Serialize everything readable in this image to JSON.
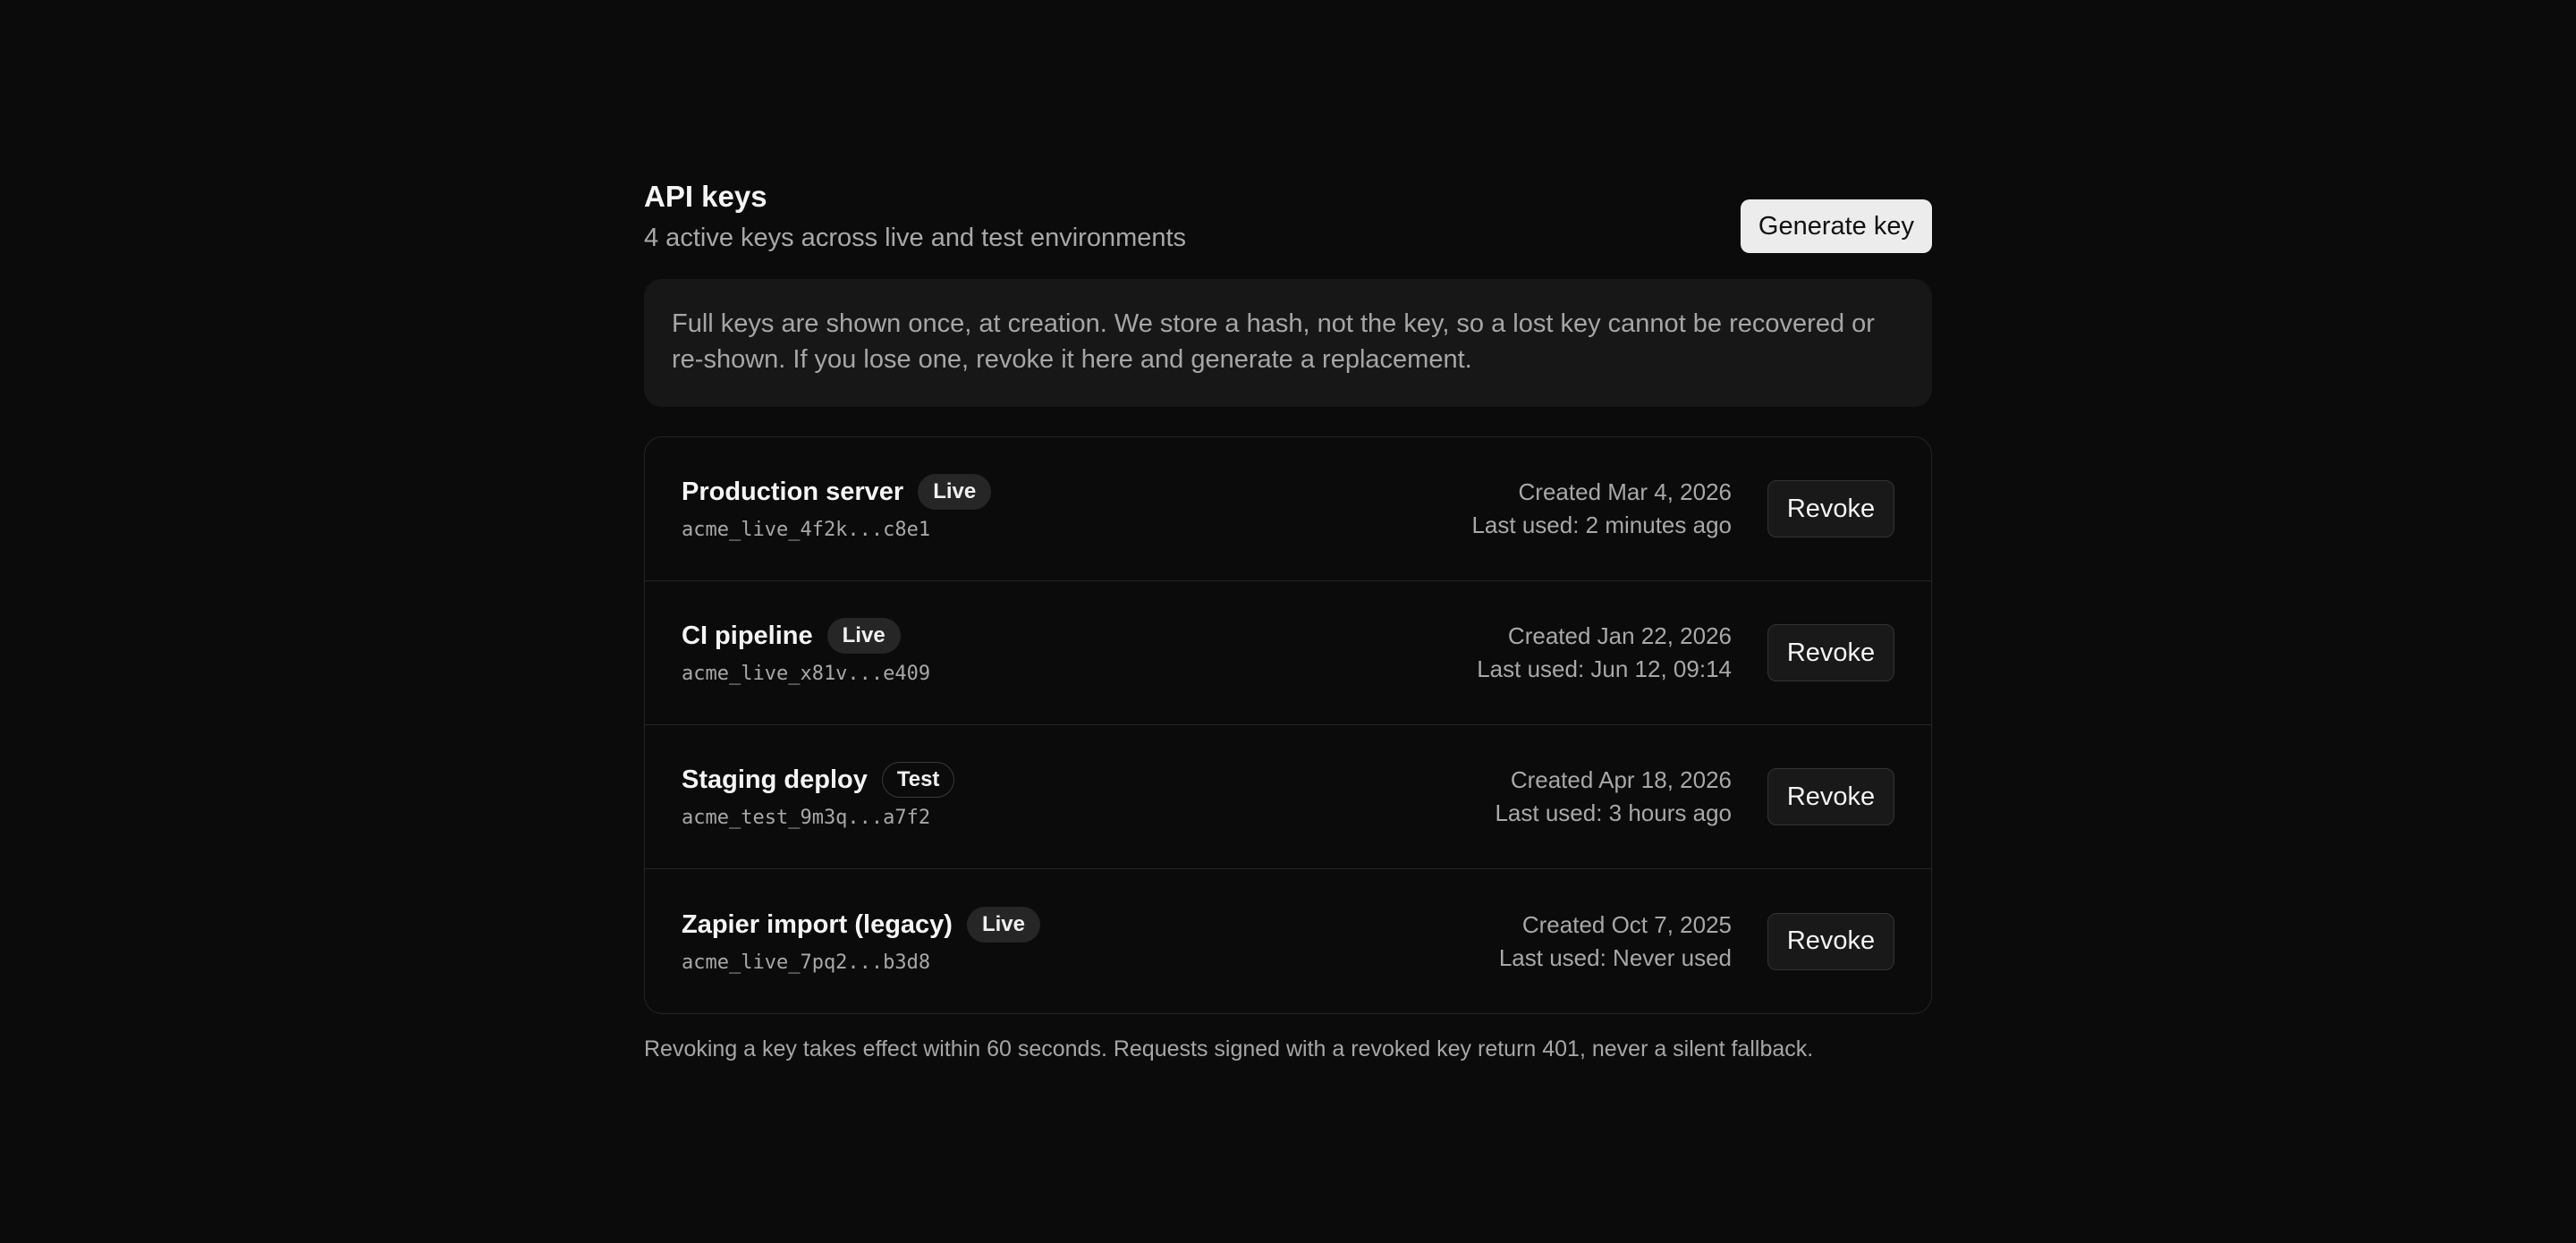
{
  "header": {
    "title": "API keys",
    "subtitle": "4 active keys across live and test environments",
    "generate_label": "Generate key"
  },
  "notice": "Full keys are shown once, at creation. We store a hash, not the key, so a lost key cannot be recovered or re-shown. If you lose one, revoke it here and generate a replacement.",
  "keys": [
    {
      "name": "Production server",
      "env": "Live",
      "id": "acme_live_4f2k...c8e1",
      "created": "Created Mar 4, 2026",
      "last_used": "Last used: 2 minutes ago",
      "action": "Revoke"
    },
    {
      "name": "CI pipeline",
      "env": "Live",
      "id": "acme_live_x81v...e409",
      "created": "Created Jan 22, 2026",
      "last_used": "Last used: Jun 12, 09:14",
      "action": "Revoke"
    },
    {
      "name": "Staging deploy",
      "env": "Test",
      "id": "acme_test_9m3q...a7f2",
      "created": "Created Apr 18, 2026",
      "last_used": "Last used: 3 hours ago",
      "action": "Revoke"
    },
    {
      "name": "Zapier import (legacy)",
      "env": "Live",
      "id": "acme_live_7pq2...b3d8",
      "created": "Created Oct 7, 2025",
      "last_used": "Last used: Never used",
      "action": "Revoke"
    }
  ],
  "footer_note": "Revoking a key takes effect within 60 seconds. Requests signed with a revoked key return 401, never a silent fallback."
}
